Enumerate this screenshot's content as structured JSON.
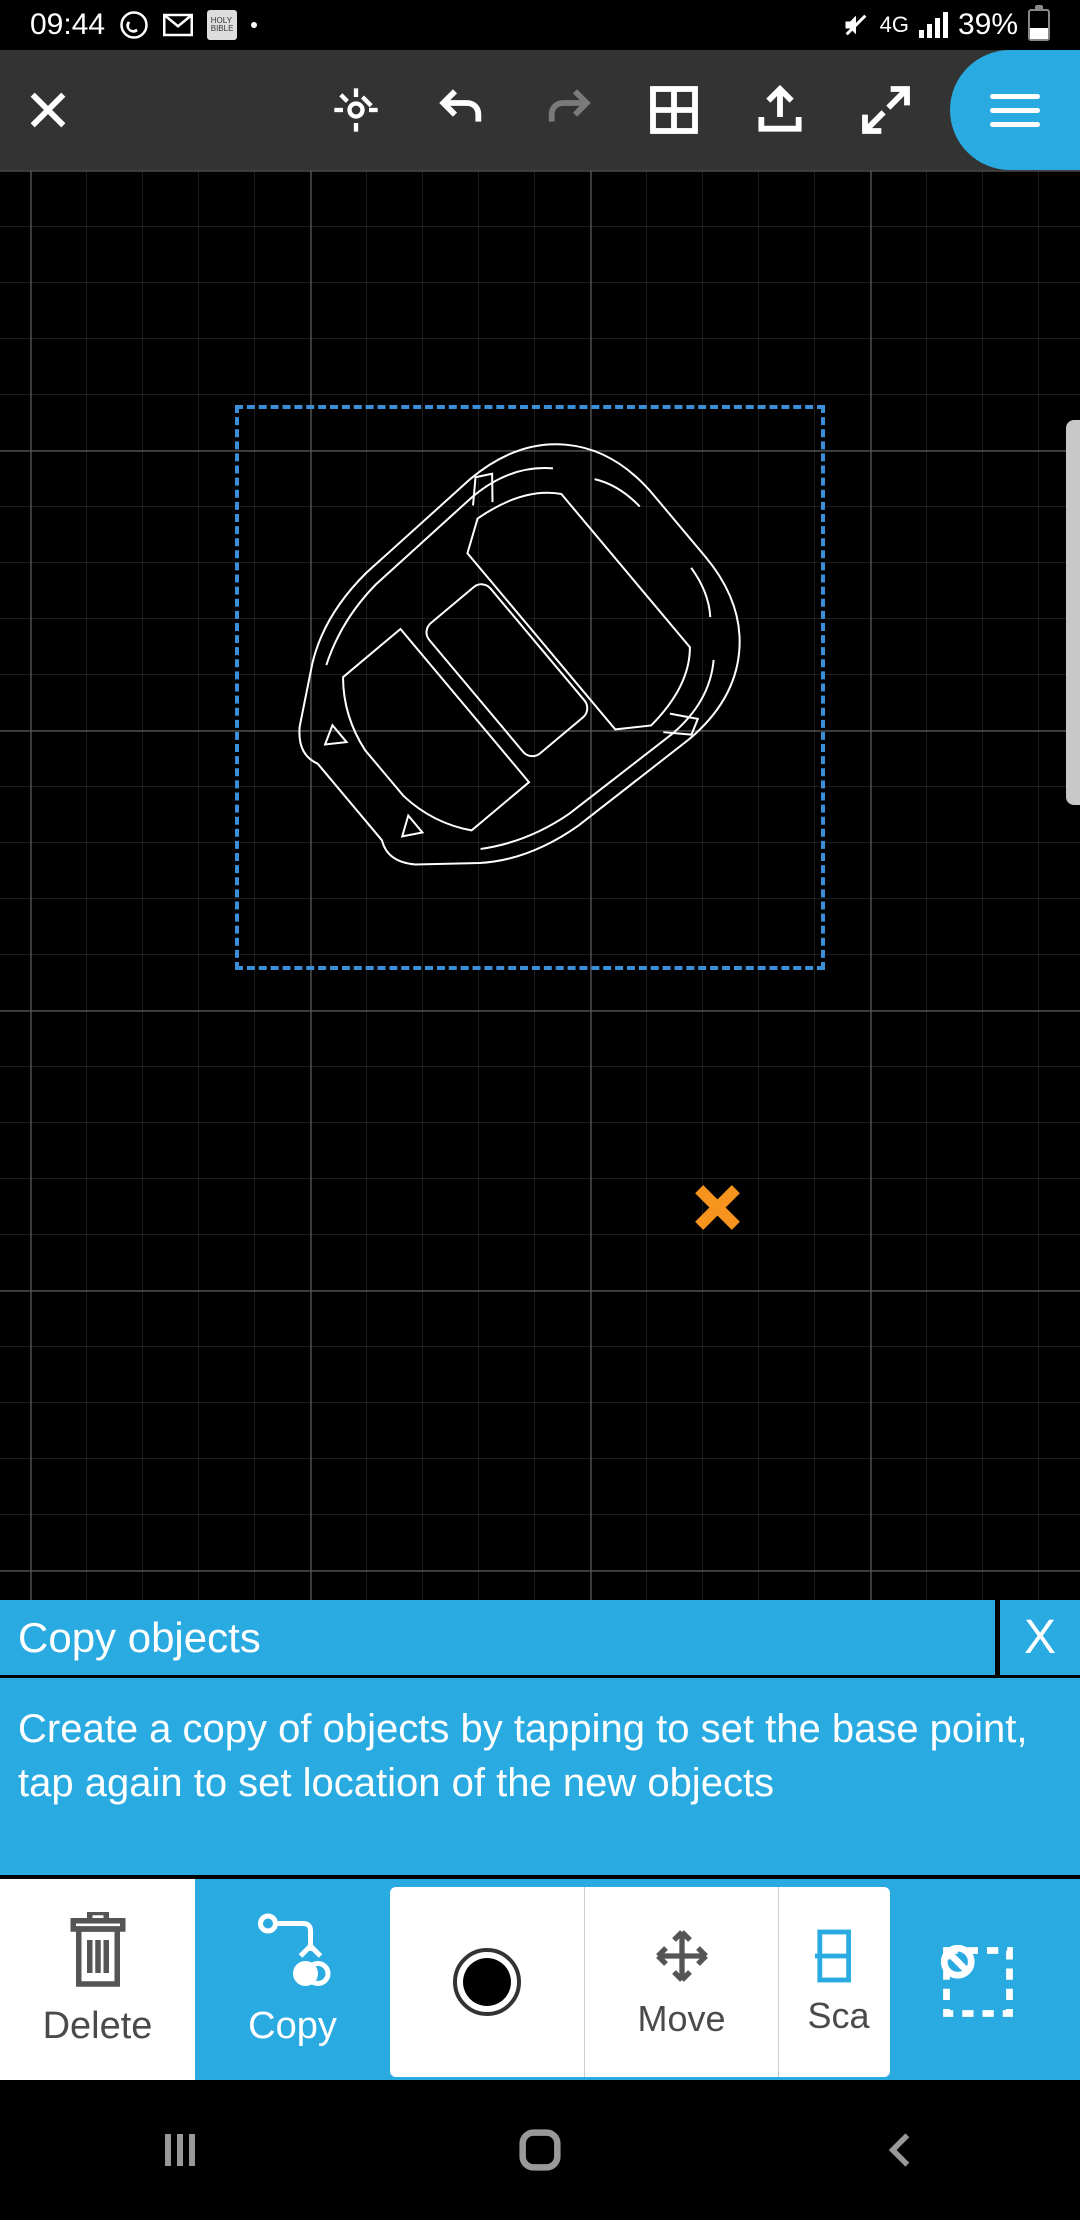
{
  "status_bar": {
    "time": "09:44",
    "network_label": "4G",
    "battery_text": "39%",
    "icons": {
      "whatsapp": "whatsapp-icon",
      "gmail": "gmail-icon",
      "bible": "bible-icon",
      "dot": "notification-dot-icon",
      "mute": "mute-icon",
      "signal": "signal-icon",
      "battery": "battery-icon"
    }
  },
  "toolbar": {
    "close": "close-icon",
    "light": "light-icon",
    "undo": "undo-icon",
    "redo": "redo-icon",
    "grid": "grid-icon",
    "share": "share-icon",
    "expand": "expand-icon",
    "menu": "menu-icon"
  },
  "canvas": {
    "selected_object": "car-top-view",
    "marker": "base-point-x-marker"
  },
  "prompt": {
    "title": "Copy objects",
    "close_label": "X",
    "instruction": "Create a copy of objects by tapping to set the base point, tap again to set location of the new objects"
  },
  "tools": {
    "delete_label": "Delete",
    "copy_label": "Copy",
    "record_label": "",
    "move_label": "Move",
    "scale_label": "Sca",
    "selection_icon": "selection-icon"
  },
  "nav": {
    "recents": "recents-icon",
    "home": "home-icon",
    "back": "back-icon"
  }
}
